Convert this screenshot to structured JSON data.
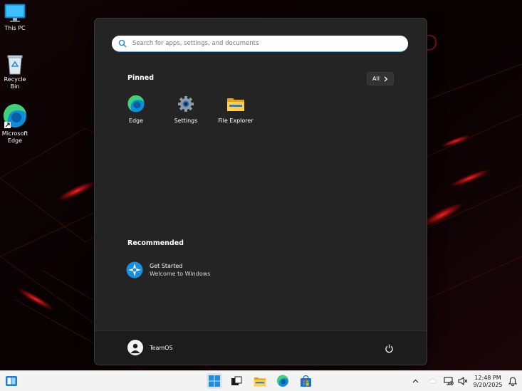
{
  "desktop": {
    "icons": [
      {
        "label": "This PC",
        "icon": "monitor-icon"
      },
      {
        "label": "Recycle Bin",
        "icon": "recycle-bin-icon"
      },
      {
        "label": "Microsoft Edge",
        "line1": "Microsoft",
        "line2": "Edge",
        "icon": "edge-icon"
      }
    ]
  },
  "start_menu": {
    "search": {
      "placeholder": "Search for apps, settings, and documents",
      "value": ""
    },
    "pinned": {
      "title": "Pinned",
      "all_label": "All",
      "apps": [
        {
          "label": "Edge",
          "icon": "edge-icon"
        },
        {
          "label": "Settings",
          "icon": "gear-icon"
        },
        {
          "label": "File Explorer",
          "icon": "folder-icon"
        }
      ]
    },
    "recommended": {
      "title": "Recommended",
      "items": [
        {
          "title": "Get Started",
          "subtitle": "Welcome to Windows",
          "icon": "get-started-icon"
        }
      ]
    },
    "user": {
      "name": "TeamOS"
    },
    "power_icon": "power-icon"
  },
  "taskbar": {
    "apps": [
      "windows-start-icon",
      "task-view-icon",
      "file-explorer-icon",
      "edge-icon",
      "store-icon"
    ],
    "clock": {
      "time": "12:48 PM",
      "date": "9/20/2025"
    }
  },
  "colors": {
    "accent": "#4cc2ff",
    "menu_bg": "#242424",
    "taskbar_bg": "#f3f3f3"
  }
}
